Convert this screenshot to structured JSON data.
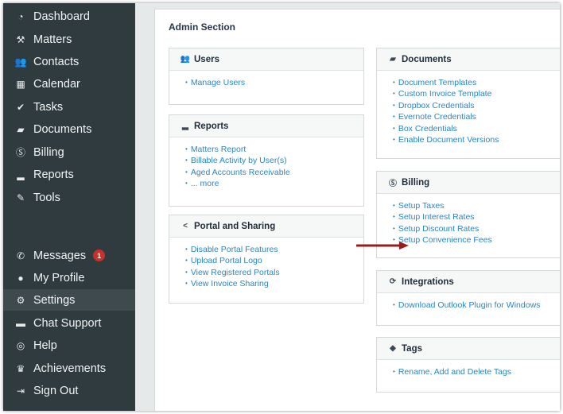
{
  "sidebar": {
    "items": [
      {
        "label": "Dashboard",
        "icon": "dashboard-icon"
      },
      {
        "label": "Matters",
        "icon": "gavel-icon"
      },
      {
        "label": "Contacts",
        "icon": "contacts-icon"
      },
      {
        "label": "Calendar",
        "icon": "calendar-icon"
      },
      {
        "label": "Tasks",
        "icon": "check-icon"
      },
      {
        "label": "Documents",
        "icon": "folder-icon"
      },
      {
        "label": "Billing",
        "icon": "billing-icon"
      },
      {
        "label": "Reports",
        "icon": "bar-chart-icon"
      },
      {
        "label": "Tools",
        "icon": "wrench-icon"
      }
    ],
    "bottom_items": [
      {
        "label": "Messages",
        "icon": "phone-icon",
        "badge": "1"
      },
      {
        "label": "My Profile",
        "icon": "user-icon"
      },
      {
        "label": "Settings",
        "icon": "gear-icon"
      },
      {
        "label": "Chat Support",
        "icon": "chat-icon"
      },
      {
        "label": "Help",
        "icon": "lifebuoy-icon"
      },
      {
        "label": "Achievements",
        "icon": "trophy-icon"
      },
      {
        "label": "Sign Out",
        "icon": "sign-out-icon"
      }
    ],
    "active": "Settings"
  },
  "main": {
    "title": "Admin Section",
    "users": {
      "title": "Users",
      "links": [
        "Manage Users"
      ]
    },
    "reports": {
      "title": "Reports",
      "links": [
        "Matters Report",
        "Billable Activity by User(s)",
        "Aged Accounts Receivable",
        "... more"
      ]
    },
    "portal": {
      "title": "Portal and Sharing",
      "links": [
        "Disable Portal Features",
        "Upload Portal Logo",
        "View Registered Portals",
        "View Invoice Sharing"
      ]
    },
    "documents": {
      "title": "Documents",
      "links": [
        "Document Templates",
        "Custom Invoice Template",
        "Dropbox Credentials",
        "Evernote Credentials",
        "Box Credentials",
        "Enable Document Versions"
      ]
    },
    "billing": {
      "title": "Billing",
      "links": [
        "Setup Taxes",
        "Setup Interest Rates",
        "Setup Discount Rates",
        "Setup Convenience Fees"
      ]
    },
    "integrations": {
      "title": "Integrations",
      "links": [
        "Download Outlook Plugin for Windows"
      ]
    },
    "tags": {
      "title": "Tags",
      "links": [
        "Rename, Add and Delete Tags"
      ]
    }
  },
  "colors": {
    "sidebar_bg": "#2f3b3f",
    "link": "#2a86c5",
    "badge": "#c9302c",
    "annotation_arrow": "#9b1b1b"
  }
}
